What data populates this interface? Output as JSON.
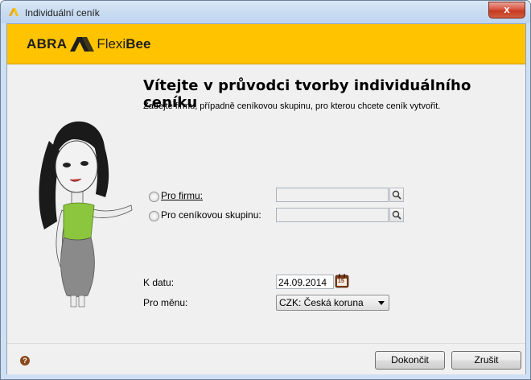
{
  "window": {
    "title": "Individuální ceník",
    "close_label": "x"
  },
  "banner": {
    "logo_left": "ABRA",
    "logo_flexi": "Flexi",
    "logo_bee": "Bee",
    "color": "#ffc300"
  },
  "main": {
    "heading": "Vítejte v průvodci tvorby individuálního ceníku",
    "subtitle": "Zadejte firmu, případně ceníkovou skupinu, pro kterou chcete ceník vytvořit."
  },
  "options": [
    {
      "label": "Pro firmu:",
      "value": "",
      "selected": false
    },
    {
      "label": "Pro ceníkovou skupinu:",
      "value": "",
      "selected": false
    }
  ],
  "date": {
    "label": "K datu:",
    "value": "24.09.2014",
    "calendar_icon_text": "15"
  },
  "currency": {
    "label": "Pro měnu:",
    "selected": "CZK: Česká koruna"
  },
  "footer": {
    "help_label": "?",
    "finish_label": "Dokončit",
    "cancel_label": "Zrušit"
  }
}
